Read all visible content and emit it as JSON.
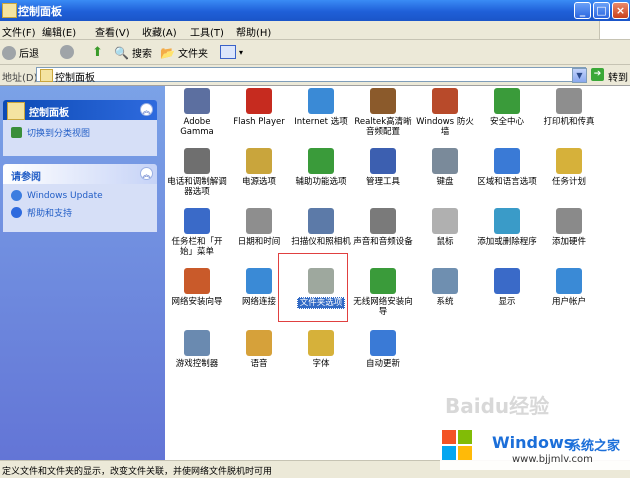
{
  "window": {
    "title": "控制面板",
    "buttons": [
      "_",
      "□",
      "×"
    ]
  },
  "menu": [
    "文件(F)",
    "编辑(E)",
    "查看(V)",
    "收藏(A)",
    "工具(T)",
    "帮助(H)"
  ],
  "toolbar": {
    "back": "后退",
    "search": "搜索",
    "folders": "文件夹"
  },
  "address": {
    "label": "地址(D)",
    "value": "控制面板",
    "go": "转到"
  },
  "sidebar": {
    "panel1": {
      "title": "控制面板",
      "link": "切换到分类视图"
    },
    "panel2": {
      "title": "请参阅",
      "links": [
        "Windows Update",
        "帮助和支持"
      ]
    }
  },
  "items": [
    [
      "Adobe Gamma",
      "Flash Player",
      "Internet 选项",
      "Realtek高清晰音频配置",
      "Windows 防火墙",
      "安全中心",
      "打印机和传真"
    ],
    [
      "电话和调制解调器选项",
      "电源选项",
      "辅助功能选项",
      "管理工具",
      "键盘",
      "区域和语言选项",
      "任务计划"
    ],
    [
      "任务栏和「开始」菜单",
      "日期和时间",
      "扫描仪和照相机",
      "声音和音频设备",
      "鼠标",
      "添加或删除程序",
      "添加硬件"
    ],
    [
      "网络安装向导",
      "网络连接",
      "文件夹选项",
      "无线网络安装向导",
      "系统",
      "显示",
      "用户帐户"
    ],
    [
      "游戏控制器",
      "语音",
      "字体",
      "自动更新"
    ]
  ],
  "selected_item": "文件夹选项",
  "status": "定义文件和文件夹的显示，改变文件关联，并使网络文件脱机时可用",
  "watermark": "Baidu经验",
  "branding": {
    "brand": "Windows",
    "brand_cn": "系统之家",
    "url": "www.bjjmlv.com"
  }
}
